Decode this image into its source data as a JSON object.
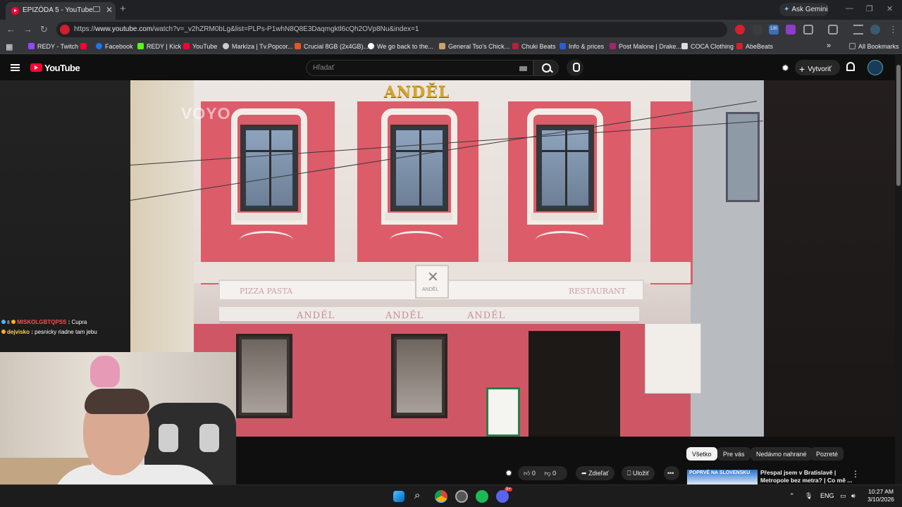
{
  "browser": {
    "tab_title": "EPIZÓDA 5 - YouTube",
    "new_tab_symbol": "+",
    "close_symbol": "✕",
    "gemini_label": "Ask Gemini",
    "url_prefix": "https://",
    "url_host": "www.youtube.com",
    "url_rest": "/watch?v=_v2hZRM0bLg&list=PLPs-P1whN8Q8E3Daqmgktl6cQh2OVp8Nu&index=1",
    "extension_badge": "130"
  },
  "bookmarks": [
    {
      "label": "REDY - Twitch",
      "color": "#9146ff"
    },
    {
      "label": "",
      "color": "#ff0033"
    },
    {
      "label": "Facebook",
      "color": "#1877f2"
    },
    {
      "label": "REDY | Kick",
      "color": "#53fc18"
    },
    {
      "label": "YouTube",
      "color": "#ff0033"
    },
    {
      "label": "Markíza | Tv.Popcor...",
      "color": "#cccccc"
    },
    {
      "label": "Crucial 8GB (2x4GB)...",
      "color": "#e05a1c"
    },
    {
      "label": "We go back to the...",
      "color": "#ffffff"
    },
    {
      "label": "General Tso's Chick...",
      "color": "#c9a36a"
    },
    {
      "label": "Chuki Beats",
      "color": "#b5223a"
    },
    {
      "label": "Info & prices",
      "color": "#2b5cd6"
    },
    {
      "label": "Post Malone | Drake...",
      "color": "#a3246d"
    },
    {
      "label": "COCA Clothing",
      "color": "#dddddd"
    },
    {
      "label": "AbeBeats",
      "color": "#d4202f"
    }
  ],
  "bookmarks_more": "»",
  "all_bookmarks": "All Bookmarks",
  "youtube": {
    "logo_text": "YouTube",
    "search_placeholder": "Hľadať",
    "create_label": "Vytvoriť"
  },
  "video": {
    "watermark": "VOYO",
    "sign_top": "ANDĚL",
    "band_left": "PIZZA PASTA",
    "band_right": "RESTAURANT",
    "emblem_text": "ANDĚL",
    "awning_words": [
      "ANDĚL",
      "ANDĚL",
      "ANDĚL"
    ]
  },
  "chat": [
    {
      "user": "MISKOLGBTQPSS",
      "sep": ":",
      "message": "Cupra",
      "user_color": "#ff4d4d",
      "badge_count": "8"
    },
    {
      "user": "dejvisko",
      "sep": ":",
      "message": "pesnicky riadne tam jebu",
      "user_color": "#ffd24d",
      "badge_count": ""
    }
  ],
  "chips": [
    {
      "label": "Všetko",
      "active": true
    },
    {
      "label": "Pre vás",
      "active": false
    },
    {
      "label": "Nedávno nahrané",
      "active": false
    },
    {
      "label": "Pozreté",
      "active": false
    }
  ],
  "actions": {
    "likes": "0",
    "dislikes": "0",
    "share": "Zdieľať",
    "save": "Uložiť",
    "more": "•••"
  },
  "recommendation": {
    "thumb_text": "POPRVÉ NA SLOVENSKU",
    "title": "Přespal jsem v Bratislavě | Metropole bez metra? | Co mě ..."
  },
  "taskbar": {
    "lang": "ENG",
    "time": "10:27 AM",
    "date": "3/10/2026",
    "discord_badge": "9+"
  }
}
